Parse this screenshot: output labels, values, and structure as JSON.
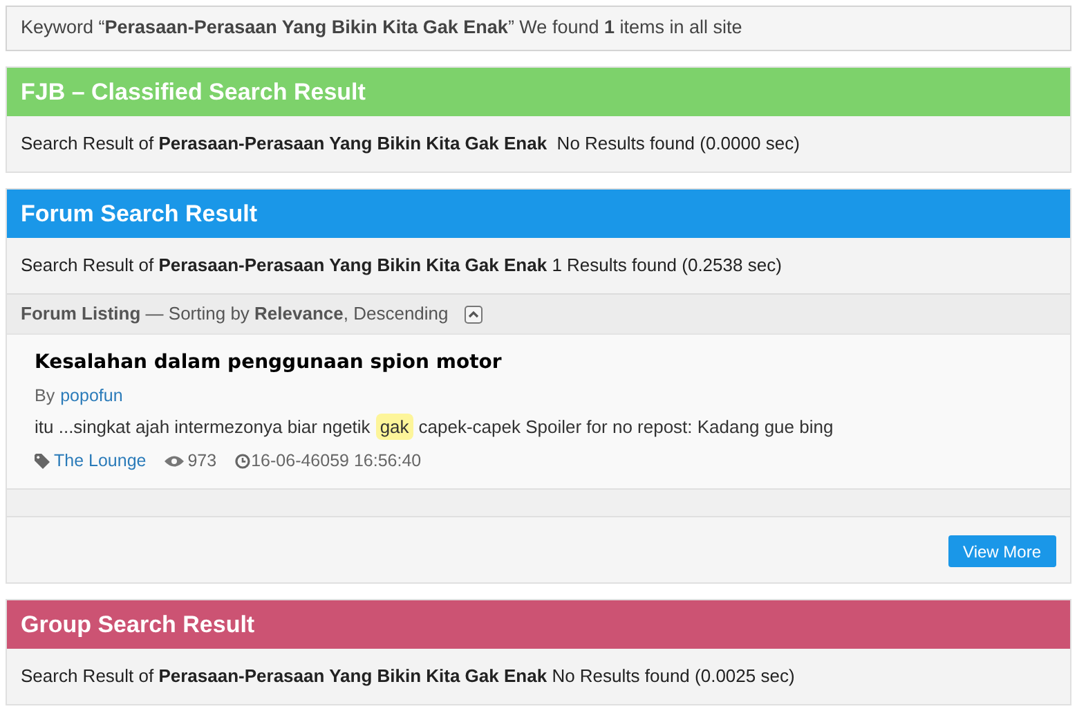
{
  "keyword_bar": {
    "text": "Keyword “**Perasaan-Perasaan Yang Bikin Kita Gak Enak**” We found **1** items in all site"
  },
  "sections": [
    {
      "kind": "plain",
      "title": "FJB – Classified Search Result",
      "color": "#7dd26b",
      "summary": "Search Result of **Perasaan-Perasaan Yang Bikin Kita Gak Enak**  No Results found (0.0000 sec)"
    },
    {
      "kind": "listing",
      "title": "Forum Search Result",
      "color": "#1a97e8",
      "summary": "Search Result of **Perasaan-Perasaan Yang Bikin Kita Gak Enak** 1 Results found (0.2538 sec)",
      "listing": {
        "heading": "**Forum Listing** — Sorting by **Relevance**, Descending",
        "posts": [
          {
            "title": "Kesalahan dalam penggunaan spion motor",
            "by_label": "By",
            "author": "popofun",
            "excerpt_before": "itu ...singkat ajah intermezonya biar ngetik",
            "highlight": "gak",
            "excerpt_after": "capek-capek Spoiler for no repost: Kadang gue bing",
            "category": "The Lounge",
            "views": "973",
            "date": "16-06-46059 16:56:40"
          }
        ],
        "view_more": "View More"
      }
    },
    {
      "kind": "plain",
      "title": "Group Search Result",
      "color": "#cc5373",
      "summary": "Search Result of **Perasaan-Perasaan Yang Bikin Kita Gak Enak** No Results found (0.0025 sec)"
    }
  ]
}
